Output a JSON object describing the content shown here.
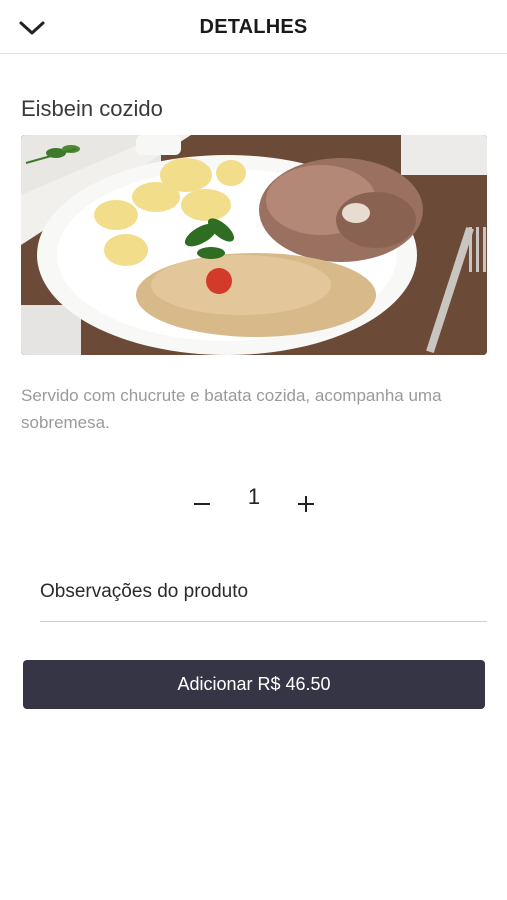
{
  "header": {
    "title": "DETALHES",
    "back_icon": "chevron-down-icon"
  },
  "product": {
    "name": "Eisbein cozido",
    "image_alt": "Eisbein cozido",
    "description": "Servido com chucrute e batata cozida, acompanha uma sobremesa."
  },
  "quantity": {
    "value": "1",
    "minus_symbol": "−",
    "plus_symbol": "+"
  },
  "observations": {
    "placeholder": "Observações do produto",
    "value": ""
  },
  "add_button": {
    "label": "Adicionar R$ 46.50"
  },
  "colors": {
    "button_bg": "#363545",
    "description_text": "#9a9a9a",
    "divider": "#e3e3e3"
  }
}
